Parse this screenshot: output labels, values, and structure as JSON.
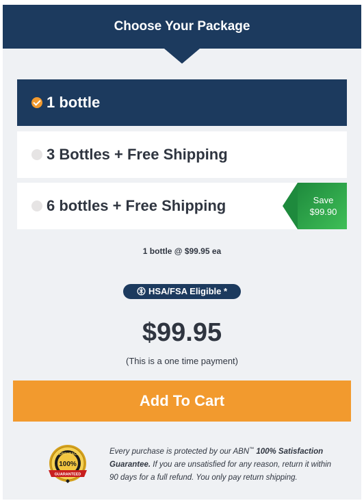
{
  "header": {
    "title": "Choose Your Package"
  },
  "options": [
    {
      "label": "1 bottle",
      "selected": true
    },
    {
      "label": "3 Bottles + Free Shipping",
      "selected": false
    },
    {
      "label": "6 bottles + Free Shipping",
      "selected": false,
      "badge_line1": "Save",
      "badge_line2": "$99.90"
    }
  ],
  "price_per": "1 bottle @ $99.95 ea",
  "hsa_badge": "HSA/FSA Eligible *",
  "price": "$99.95",
  "payment_note": "(This is a one time payment)",
  "cta": {
    "label": "Add To Cart"
  },
  "seal": {
    "top_text": "MONEYBACK",
    "number": "100%",
    "sub_text": "GUARANTEED"
  },
  "guarantee": {
    "part1": "Every purchase is protected by our ABN",
    "tm": "™",
    "bold": "100% Satisfaction Guarantee.",
    "part2": " If you are unsatisfied for any reason, return it within 90 days for a full refund. You only pay return shipping."
  },
  "colors": {
    "navy": "#1c3a5e",
    "orange": "#f29a2e",
    "green": "#2ea84b",
    "panel": "#eff1f4"
  }
}
